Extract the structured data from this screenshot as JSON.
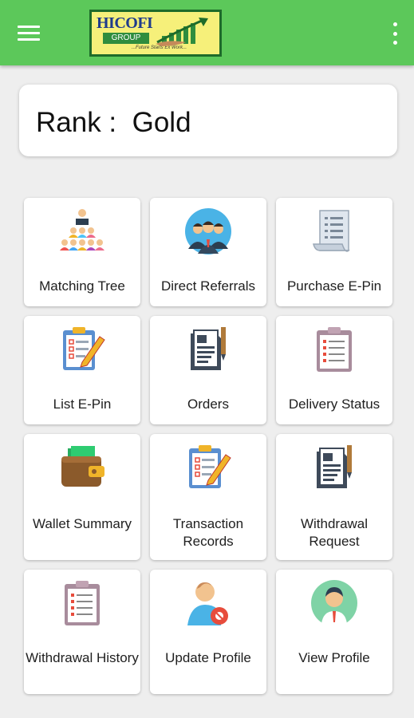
{
  "app_bar": {
    "background_color": "#5cc85a",
    "menu_icon": "hamburger-menu-icon",
    "overflow_icon": "more-vertical-icon",
    "logo": {
      "brand": "HICOFI",
      "sub": "GROUP",
      "tagline": "...Future Starts Ex Work..."
    }
  },
  "rank": {
    "text": "Rank :  Gold"
  },
  "tiles": [
    {
      "label": "Matching Tree",
      "icon": "team-hierarchy-icon"
    },
    {
      "label": "Direct Referrals",
      "icon": "group-people-icon"
    },
    {
      "label": "Purchase E-Pin",
      "icon": "receipt-list-icon"
    },
    {
      "label": "List E-Pin",
      "icon": "checklist-clipboard-pencil-icon"
    },
    {
      "label": "Orders",
      "icon": "document-pen-icon"
    },
    {
      "label": "Delivery Status",
      "icon": "clipboard-list-icon"
    },
    {
      "label": "Wallet Summary",
      "icon": "wallet-icon"
    },
    {
      "label": "Transaction Records",
      "icon": "checklist-clipboard-pencil-icon"
    },
    {
      "label": "Withdrawal Request",
      "icon": "document-pen-icon"
    },
    {
      "label": "Withdrawal History",
      "icon": "clipboard-list-icon"
    },
    {
      "label": "Update Profile",
      "icon": "user-edit-icon"
    },
    {
      "label": "View Profile",
      "icon": "user-avatar-icon"
    }
  ]
}
